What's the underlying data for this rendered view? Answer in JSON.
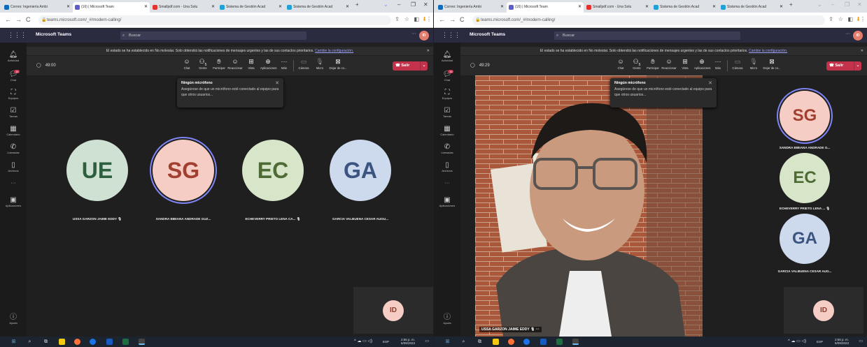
{
  "browser": {
    "tabs": [
      {
        "label": "Correo: Ingeniería Ambi",
        "color": "#0f6cbd"
      },
      {
        "label": "(16) | Microsoft Team",
        "color": "#5b5fc7"
      },
      {
        "label": "Smallpdf.com - Una Solu",
        "color": "#e5322d"
      },
      {
        "label": "Sistema de Gestión Acad",
        "color": "#1fa2d7"
      },
      {
        "label": "Sistema de Gestión Acad",
        "color": "#1fa2d7"
      }
    ],
    "new_tab": "+",
    "url": "teams.microsoft.com/_#/modern-calling/"
  },
  "teams": {
    "brand": "Microsoft Teams",
    "search_placeholder": "Buscar",
    "me_initials": "ID",
    "more": "···",
    "notice_text": "El estado se ha establecido en No molestar. Solo obtendrá las notificaciones de mensajes urgentes y las de sus contactos prioritarios.",
    "notice_link": "Cambie la configuración.",
    "rail": [
      {
        "label": "Actividad",
        "icon": "bell-icon"
      },
      {
        "label": "Chat",
        "icon": "chat-icon",
        "badge": "16"
      },
      {
        "label": "Equipos",
        "icon": "teams-icon"
      },
      {
        "label": "Tareas",
        "icon": "tasks-icon"
      },
      {
        "label": "Calendario",
        "icon": "calendar-icon"
      },
      {
        "label": "Llamadas",
        "icon": "phone-icon"
      },
      {
        "label": "Archivos",
        "icon": "files-icon"
      },
      {
        "label": "···",
        "icon": "more-icon"
      },
      {
        "label": "Aplicaciones",
        "icon": "apps-icon"
      }
    ],
    "help": "Ayuda",
    "toolbar": [
      {
        "label": "Chat",
        "icon": "chat-icon"
      },
      {
        "label": "Gente",
        "icon": "people-icon",
        "count": "5"
      },
      {
        "label": "Participar",
        "icon": "raise-hand-icon"
      },
      {
        "label": "Reaccionar",
        "icon": "smile-icon"
      },
      {
        "label": "Vista",
        "icon": "view-icon"
      },
      {
        "label": "Aplicaciones",
        "icon": "apps-plus-icon"
      },
      {
        "label": "Más",
        "icon": "more-icon"
      }
    ],
    "device_toolbar": [
      {
        "label": "Cámara",
        "icon": "camera-off-icon"
      },
      {
        "label": "Micro",
        "icon": "mic-off-icon"
      },
      {
        "label": "Dejar de co...",
        "icon": "stop-share-icon"
      }
    ],
    "leave_label": "Salir",
    "mic_tip": {
      "title": "Ningún micrófono",
      "body": "Asegúrese de que un micrófono esté conectado al equipo para que otros usuarios..."
    }
  },
  "left_call": {
    "timer": "49:00",
    "participants": [
      {
        "initials": "UE",
        "name": "USSA GARZON JAIME EDDY"
      },
      {
        "initials": "SG",
        "name": "SANDRA BIBIANA ANDRADE GUZ..."
      },
      {
        "initials": "EC",
        "name": "ECHEVERRY PRIETO LENA CA..."
      },
      {
        "initials": "GA",
        "name": "GARCIA VALBUENA CESAR AUGU..."
      }
    ],
    "self_initials": "ID"
  },
  "right_call": {
    "timer": "49:29",
    "video_name": "USSA GARZON JAIME EDDY",
    "video_more": "···",
    "side_participants": [
      {
        "initials": "SG",
        "name": "SANDRA BIBIANA ANDRADE G..."
      },
      {
        "initials": "EC",
        "name": "ECHEVERRY PRIETO LENA ..."
      },
      {
        "initials": "GA",
        "name": "GARCIA VALBUENA CESAR AUG..."
      }
    ],
    "self_initials": "ID"
  },
  "taskbar": {
    "time": "2:56 p. m.",
    "date": "5/09/2023",
    "lang": "ESP"
  }
}
